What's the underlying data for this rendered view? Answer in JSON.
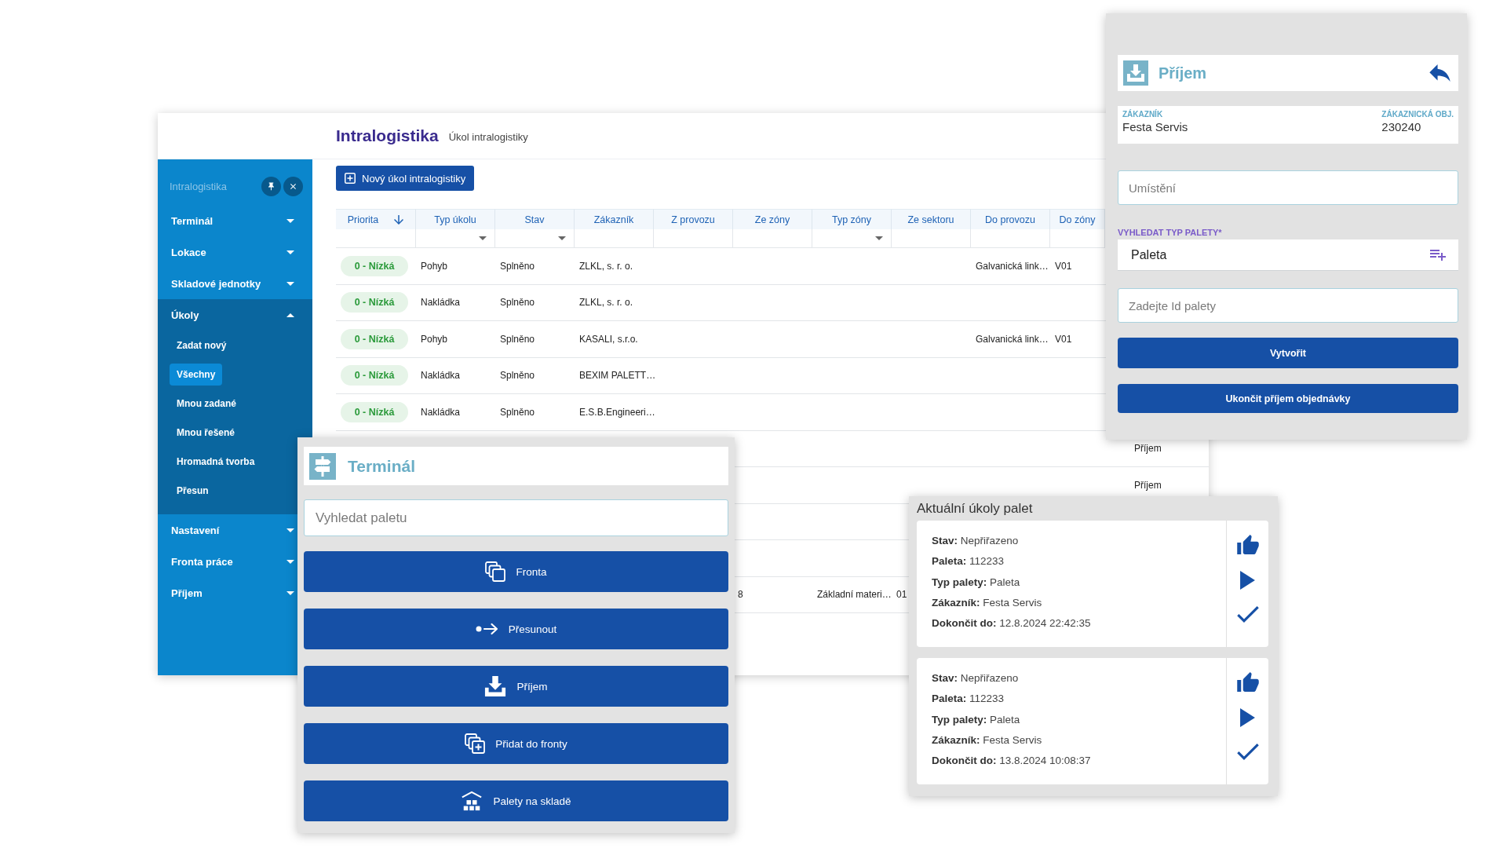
{
  "main_window": {
    "header": {
      "title": "Intralogistika",
      "subtitle": "Úkol intralogistiky"
    },
    "sidebar": {
      "title": "Intralogistika",
      "items": [
        {
          "label": "Terminál",
          "expanded": false
        },
        {
          "label": "Lokace",
          "expanded": false
        },
        {
          "label": "Skladové jednotky",
          "expanded": false
        },
        {
          "label": "Úkoly",
          "expanded": true,
          "children": [
            {
              "label": "Zadat nový",
              "selected": false
            },
            {
              "label": "Všechny",
              "selected": true
            },
            {
              "label": "Mnou zadané",
              "selected": false
            },
            {
              "label": "Mnou řešené",
              "selected": false
            },
            {
              "label": "Hromadná tvorba",
              "selected": false
            },
            {
              "label": "Přesun",
              "selected": false
            }
          ]
        },
        {
          "label": "Nastavení",
          "expanded": false
        },
        {
          "label": "Fronta práce",
          "expanded": false
        },
        {
          "label": "Příjem",
          "expanded": false
        }
      ]
    },
    "new_task_button": "Nový úkol intralogistiky",
    "table": {
      "columns": [
        {
          "label": "Priorita",
          "sorted_descending": true,
          "filter_dropdown": false
        },
        {
          "label": "Typ úkolu",
          "sorted_descending": false,
          "filter_dropdown": true
        },
        {
          "label": "Stav",
          "sorted_descending": false,
          "filter_dropdown": true
        },
        {
          "label": "Zákazník",
          "sorted_descending": false,
          "filter_dropdown": false
        },
        {
          "label": "Z provozu",
          "sorted_descending": false,
          "filter_dropdown": false
        },
        {
          "label": "Ze zóny",
          "sorted_descending": false,
          "filter_dropdown": false
        },
        {
          "label": "Typ zóny",
          "sorted_descending": false,
          "filter_dropdown": true
        },
        {
          "label": "Ze sektoru",
          "sorted_descending": false,
          "filter_dropdown": false
        },
        {
          "label": "Do provozu",
          "sorted_descending": false,
          "filter_dropdown": false
        },
        {
          "label": "Do zóny",
          "sorted_descending": false,
          "filter_dropdown": false
        }
      ],
      "rows": [
        {
          "priority": "0 - Nízká",
          "cells": [
            "Pohyb",
            "Splněno",
            "ZLKL, s. r. o.",
            null,
            null,
            null,
            null,
            "Galvanická link…",
            "V01"
          ]
        },
        {
          "priority": "0 - Nízká",
          "cells": [
            "Nakládka",
            "Splněno",
            "ZLKL, s. r. o."
          ]
        },
        {
          "priority": "0 - Nízká",
          "cells": [
            "Pohyb",
            "Splněno",
            "KASALI, s.r.o.",
            null,
            null,
            null,
            null,
            "Galvanická link…",
            "V01"
          ]
        },
        {
          "priority": "0 - Nízká",
          "cells": [
            "Nakládka",
            "Splněno",
            "BEXIM PALETT…"
          ]
        },
        {
          "priority": "0 - Nízká",
          "cells": [
            "Nakládka",
            "Splněno",
            "E.S.B.Engineeri…"
          ]
        },
        {
          "cells": [
            null,
            null,
            null,
            null,
            null,
            null,
            null,
            null,
            null,
            "Příjem"
          ]
        },
        {
          "cells": [
            null,
            null,
            null,
            null,
            null,
            null,
            null,
            null,
            null,
            "Příjem"
          ]
        },
        {},
        {},
        {
          "cells": [
            null,
            null,
            null,
            null,
            "8",
            "Základní materi…",
            "01"
          ]
        }
      ]
    }
  },
  "terminal_panel": {
    "title": "Terminál",
    "search": {
      "placeholder": "Vyhledat paletu"
    },
    "buttons": [
      {
        "label": "Fronta",
        "kind": "queue"
      },
      {
        "label": "Přesunout",
        "kind": "move"
      },
      {
        "label": "Příjem",
        "kind": "receive"
      },
      {
        "label": "Přidat do fronty",
        "kind": "add_to_queue"
      },
      {
        "label": "Palety na skladě",
        "kind": "warehouse"
      }
    ]
  },
  "receiving_panel": {
    "title": "Příjem",
    "customer": {
      "label": "ZÁKAZNÍK",
      "value": "Festa Servis"
    },
    "customer_order": {
      "label": "ZÁKAZNICKÁ OBJ.",
      "value": "230240"
    },
    "location_field": {
      "placeholder": "Umístění"
    },
    "pallet_type": {
      "label": "VYHLEDAT TYP PALETY*",
      "value": "Paleta"
    },
    "pallet_id_field": {
      "placeholder": "Zadejte Id palety"
    },
    "buttons": [
      "Vytvořit",
      "Ukončit příjem objednávky"
    ]
  },
  "pallet_tasks_panel": {
    "title": "Aktuální úkoly palet",
    "tasks": [
      {
        "lines": [
          "**Stav:** Nepřiřazeno",
          "**Paleta:** 112233",
          "**Typ palety:** Paleta",
          "**Zákazník:** Festa Servis",
          "**Dokončit do:** 12.8.2024 22:42:35"
        ]
      },
      {
        "lines": [
          "**Stav:** Nepřiřazeno",
          "**Paleta:** 112233",
          "**Typ palety:** Paleta",
          "**Zákazník:** Festa Servis",
          "**Dokončit do:** 13.8.2024 10:08:37"
        ]
      }
    ]
  }
}
